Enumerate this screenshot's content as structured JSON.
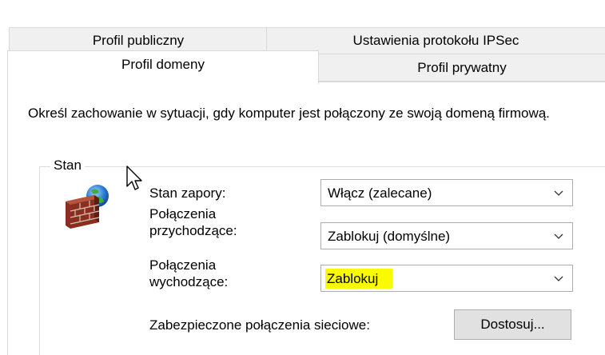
{
  "tabs": {
    "back_row": [
      "Profil publiczny",
      "Ustawienia protokołu IPSec"
    ],
    "front_row": [
      "Profil domeny",
      "Profil prywatny"
    ],
    "selected": "Profil domeny"
  },
  "description": "Określ zachowanie w sytuacji, gdy komputer jest połączony ze swoją domeną firmową.",
  "state_group": {
    "legend": "Stan",
    "icon": "firewall-globe-icon",
    "firewall_state": {
      "label": "Stan zapory:",
      "value": "Włącz (zalecane)"
    },
    "inbound": {
      "label_line1": "Połączenia",
      "label_line2": "przychodzące:",
      "value": "Zablokuj (domyślne)"
    },
    "outbound": {
      "label_line1": "Połączenia",
      "label_line2": "wychodzące:",
      "value": "Zablokuj",
      "highlight_color": "#fafa00"
    },
    "protected_connections": {
      "label": "Zabezpieczone połączenia sieciowe:",
      "button": "Dostosuj..."
    }
  }
}
